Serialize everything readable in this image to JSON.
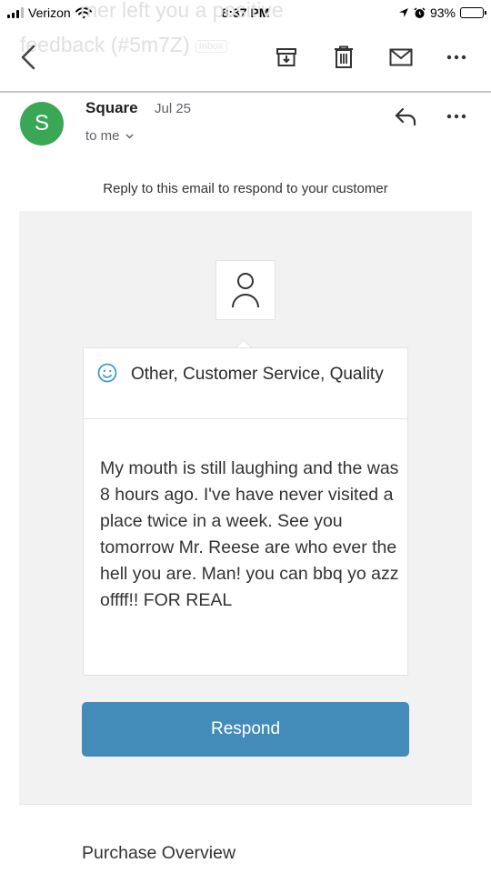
{
  "status_bar": {
    "carrier": "Verizon",
    "time": "8:37 PM",
    "battery_percent": "93%",
    "battery_level": 0.93
  },
  "subject": {
    "line1": "mer left you a positive",
    "line2": "feedback (#5m7Z)",
    "tag": "Inbox"
  },
  "toolbar": {
    "back_icon": "back-arrow-icon",
    "archive_icon": "archive-icon",
    "delete_icon": "trash-icon",
    "mark_unread_icon": "mail-icon",
    "more_icon": "more-dots-icon"
  },
  "message": {
    "avatar_letter": "S",
    "avatar_color": "#3aa757",
    "sender": "Square",
    "date": "Jul 25",
    "recipient": "to me",
    "reply_note": "Reply to this email to respond to your customer"
  },
  "feedback": {
    "categories": "Other, Customer Service, Quality",
    "comment": "My mouth is still laughing and the was 8 hours ago. I've have never visited a place twice in a week. See you tomorrow Mr. Reese are who ever the hell you are. Man! you can bbq yo azz offff!! FOR REAL",
    "icon_color": "#3b9bd1"
  },
  "actions": {
    "respond_label": "Respond",
    "respond_color": "#438cba"
  },
  "footer": {
    "purchase_overview": "Purchase Overview"
  }
}
